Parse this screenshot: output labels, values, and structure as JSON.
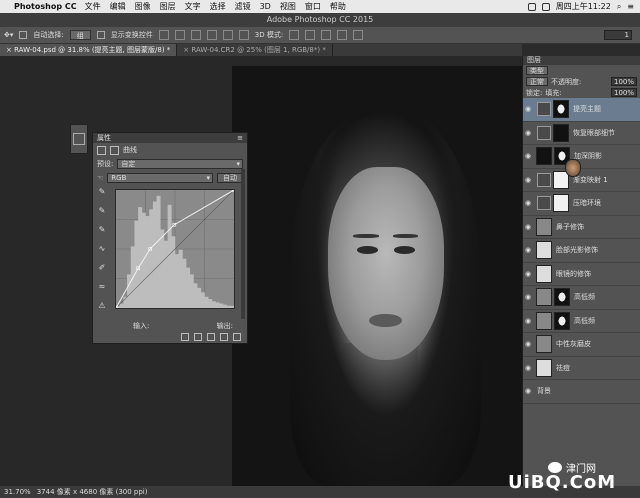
{
  "menubar": {
    "app": "Photoshop CC",
    "items": [
      "文件",
      "编辑",
      "图像",
      "图层",
      "文字",
      "选择",
      "滤镜",
      "3D",
      "视图",
      "窗口",
      "帮助"
    ],
    "clock": "周四上午11:22"
  },
  "window": {
    "title": "Adobe Photoshop CC 2015"
  },
  "options": {
    "auto_select": "自动选择:",
    "auto_select_value": "组",
    "show_transform": "显示变换控件",
    "mode_3d": "3D 模式:",
    "right_value": "1"
  },
  "tabs": [
    {
      "label": "RAW-04.psd @ 31.8% (提亮主题, 图层蒙版/8) *"
    },
    {
      "label": "RAW-04.CR2 @ 25% (图层 1, RGB/8*) *"
    }
  ],
  "properties": {
    "panel_title": "属性",
    "curves_label": "曲线",
    "preset_label": "预设:",
    "preset_value": "自定",
    "channel_value": "RGB",
    "auto_button": "自动",
    "input_label": "输入:",
    "output_label": "输出:"
  },
  "layers_panel": {
    "title": "图层",
    "filter": "类型",
    "blend_mode": "正常",
    "opacity_label": "不透明度:",
    "opacity_value": "100%",
    "lock_label": "锁定:",
    "fill_label": "填充:",
    "fill_value": "100%",
    "layers": [
      {
        "name": "提亮主题",
        "thumb": "curves",
        "mask": "face-mask",
        "selected": true
      },
      {
        "name": "恢复眼部细节",
        "thumb": "levels",
        "mask": "dark",
        "selected": false
      },
      {
        "name": "加深阴影",
        "thumb": "dark",
        "mask": "face-mask",
        "selected": false
      },
      {
        "name": "渐变映射 1",
        "thumb": "gradient",
        "mask": "white",
        "selected": false
      },
      {
        "name": "压暗环境",
        "thumb": "curves",
        "mask": "white",
        "selected": false
      },
      {
        "name": "鼻子修饰",
        "thumb": "gray",
        "mask": "",
        "selected": false
      },
      {
        "name": "脸部光影修饰",
        "thumb": "light",
        "mask": "",
        "selected": false
      },
      {
        "name": "眼镜的修饰",
        "thumb": "light",
        "mask": "",
        "selected": false
      },
      {
        "name": "高低频",
        "thumb": "gray",
        "mask": "face-mask",
        "selected": false
      },
      {
        "name": "高低频",
        "thumb": "gray",
        "mask": "face-mask",
        "selected": false
      },
      {
        "name": "中性灰磨皮",
        "thumb": "gray",
        "mask": "",
        "selected": false
      },
      {
        "name": "祛痘",
        "thumb": "light",
        "mask": "",
        "selected": false
      },
      {
        "name": "背景",
        "thumb": "photo",
        "mask": "",
        "selected": false
      }
    ]
  },
  "curve": {
    "points": [
      [
        0,
        0
      ],
      [
        48,
        86
      ],
      [
        74,
        128
      ],
      [
        126,
        180
      ],
      [
        255,
        255
      ]
    ],
    "histogram": [
      2,
      4,
      10,
      30,
      55,
      78,
      90,
      85,
      82,
      88,
      95,
      100,
      70,
      60,
      92,
      64,
      48,
      52,
      44,
      36,
      30,
      22,
      18,
      14,
      10,
      8,
      6,
      5,
      4,
      3,
      2,
      2
    ]
  },
  "status": {
    "zoom": "31.70%",
    "doc": "3744 像素 x 4680 像素 (300 ppi)"
  },
  "watermark": {
    "brand": "津门网",
    "site": "UiBQ.CoM"
  }
}
